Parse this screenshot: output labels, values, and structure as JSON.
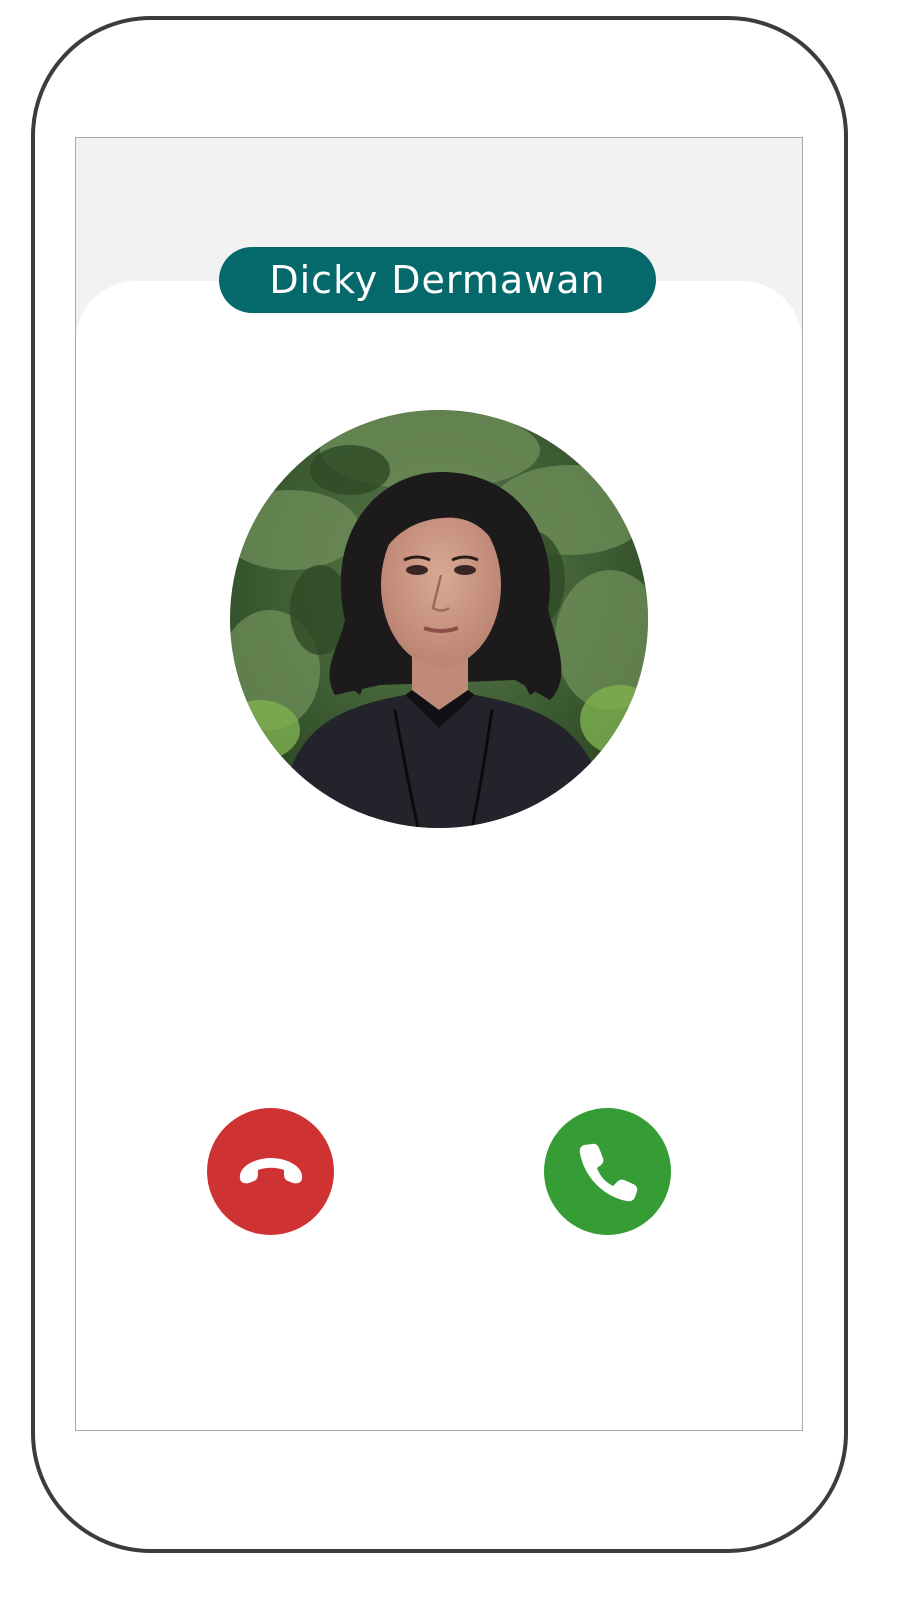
{
  "caller": {
    "name": "Dicky Dermawan"
  },
  "colors": {
    "name_pill": "#05696b",
    "decline": "#cf3232",
    "accept": "#359c36",
    "screen_bg": "#f2f2f2"
  },
  "icons": {
    "decline": "phone-hangup-icon",
    "accept": "phone-icon",
    "avatar": "caller-photo"
  }
}
